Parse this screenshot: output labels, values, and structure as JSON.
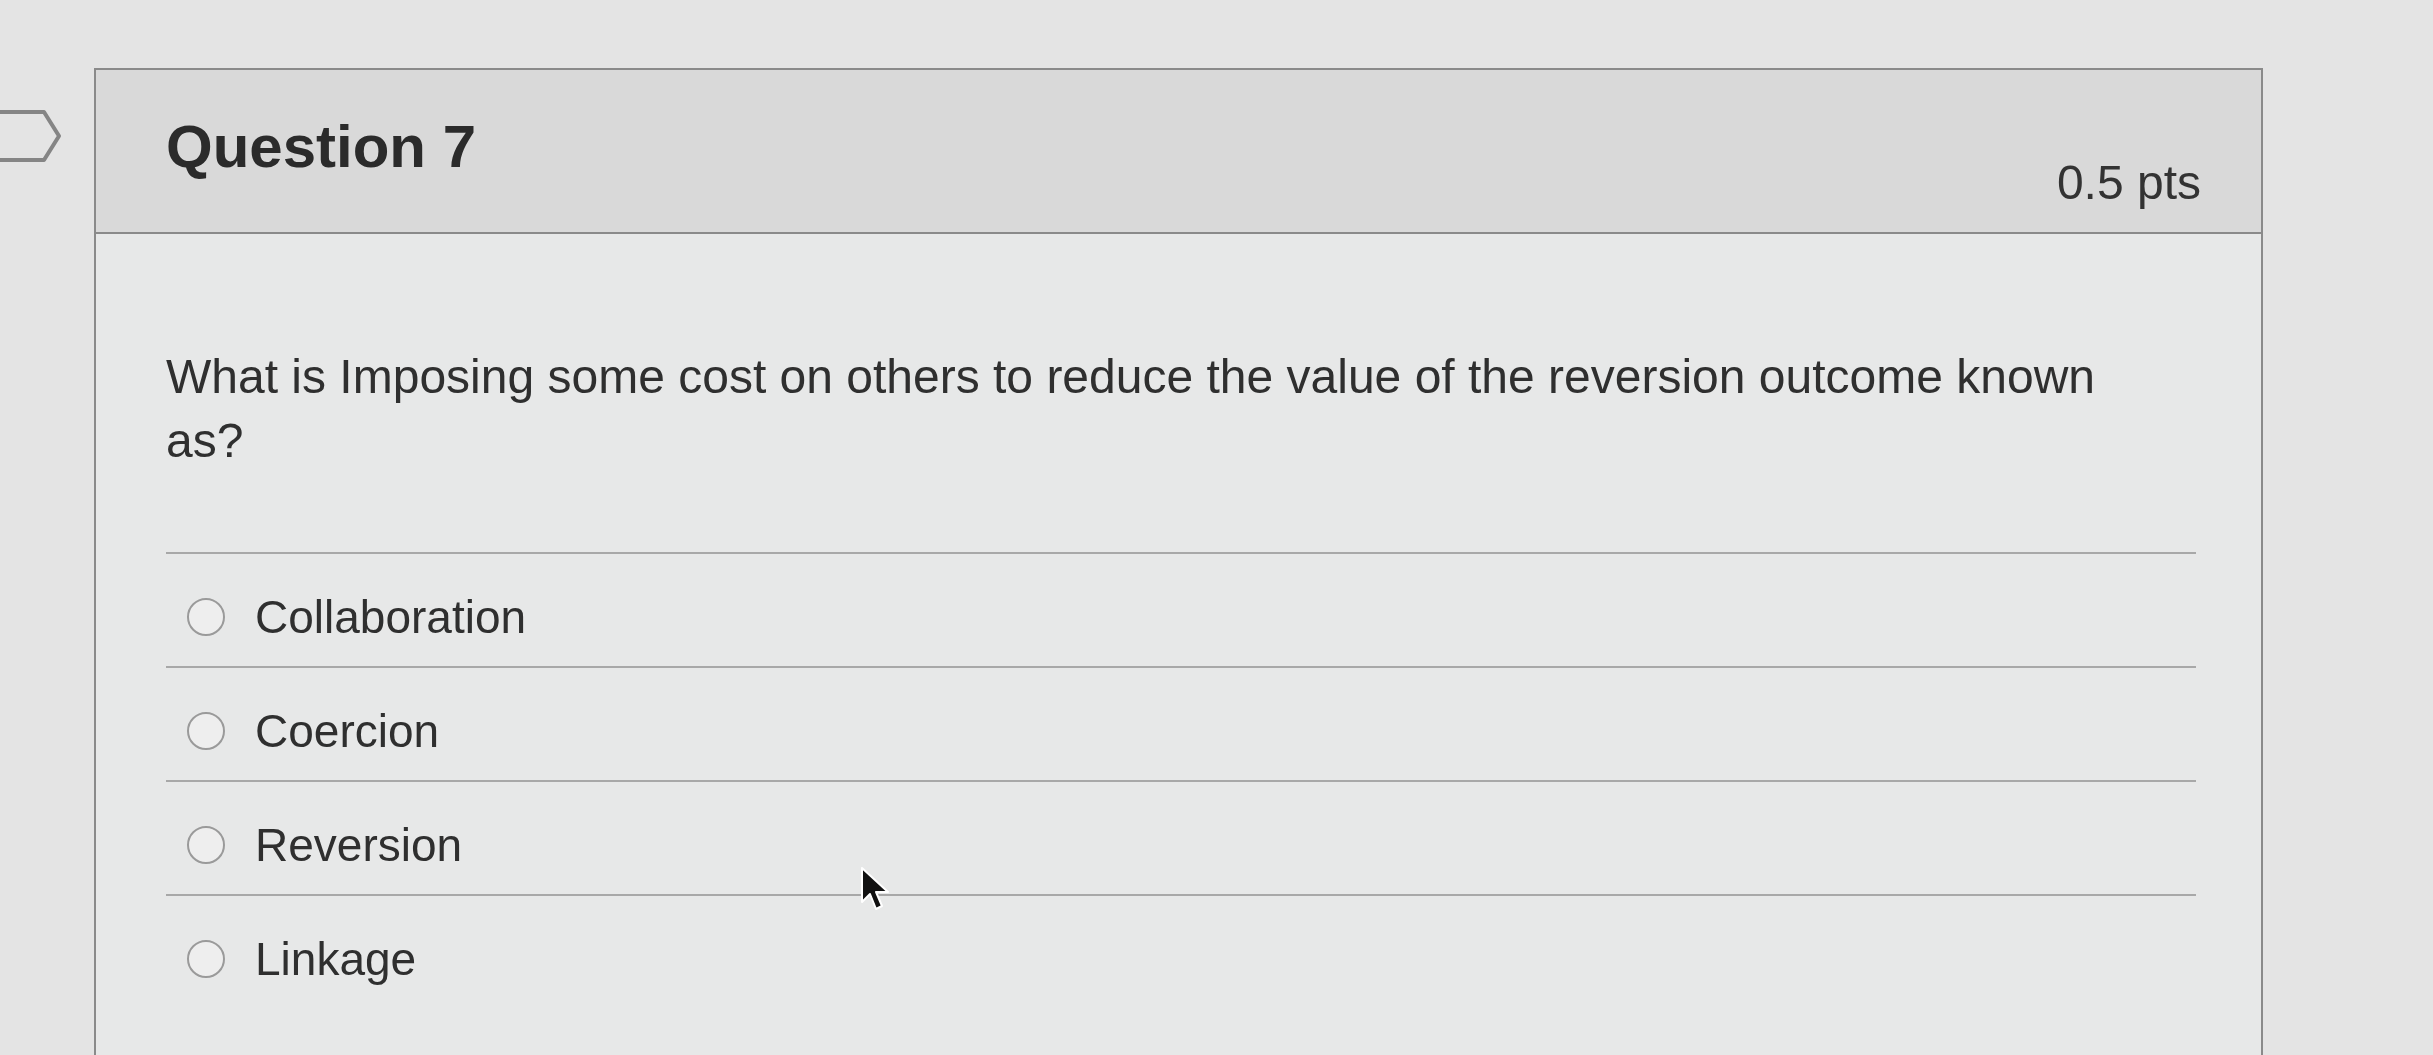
{
  "question": {
    "flagged": false,
    "title": "Question 7",
    "points": "0.5 pts",
    "text": "What is Imposing some cost on others to reduce the value of the reversion outcome known as?"
  },
  "answers": [
    {
      "label": "Collaboration",
      "selected": false
    },
    {
      "label": "Coercion",
      "selected": false
    },
    {
      "label": "Reversion",
      "selected": false
    },
    {
      "label": "Linkage",
      "selected": false
    }
  ]
}
